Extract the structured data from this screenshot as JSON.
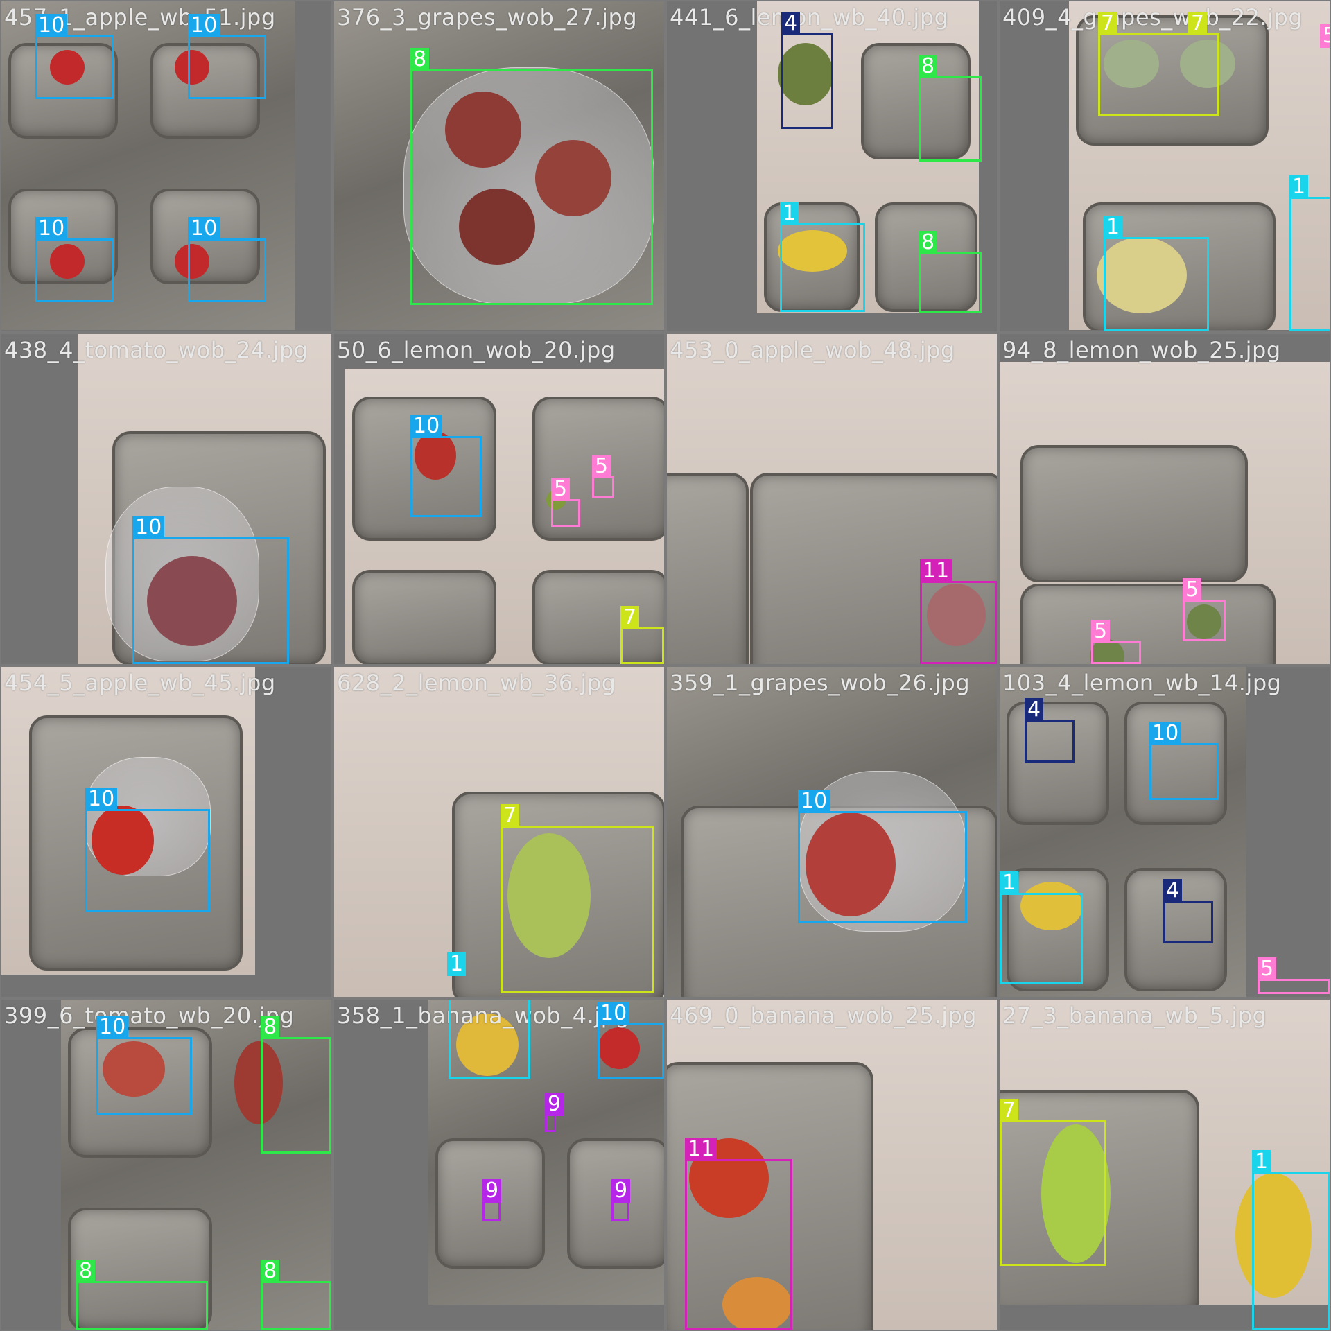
{
  "tiles": [
    {
      "filename": "457_1_apple_wb_51.jpg",
      "labels": [
        "10",
        "10",
        "10",
        "10"
      ]
    },
    {
      "filename": "376_3_grapes_wob_27.jpg",
      "labels": [
        "8"
      ]
    },
    {
      "filename": "441_6_lemon_wb_40.jpg",
      "labels": [
        "4",
        "8",
        "1",
        "8"
      ]
    },
    {
      "filename": "409_4_grapes_wob_22.jpg",
      "labels": [
        "7",
        "7",
        "5",
        "1",
        "1"
      ]
    },
    {
      "filename": "438_4_tomato_wob_24.jpg",
      "labels": [
        "10"
      ]
    },
    {
      "filename": "50_6_lemon_wob_20.jpg",
      "labels": [
        "10",
        "5",
        "5",
        "7"
      ]
    },
    {
      "filename": "453_0_apple_wob_48.jpg",
      "labels": [
        "11"
      ]
    },
    {
      "filename": "94_8_lemon_wob_25.jpg",
      "labels": [
        "5",
        "5"
      ]
    },
    {
      "filename": "454_5_apple_wb_45.jpg",
      "labels": [
        "10"
      ]
    },
    {
      "filename": "628_2_lemon_wb_36.jpg",
      "labels": [
        "7",
        "1"
      ]
    },
    {
      "filename": "359_1_grapes_wob_26.jpg",
      "labels": [
        "10"
      ]
    },
    {
      "filename": "103_4_lemon_wb_14.jpg",
      "labels": [
        "4",
        "10",
        "1",
        "4",
        "5"
      ]
    },
    {
      "filename": "399_6_tomato_wb_20.jpg",
      "labels": [
        "10",
        "8",
        "8",
        "8"
      ]
    },
    {
      "filename": "358_1_banana_wob_4.jpg",
      "labels": [
        "10",
        "9",
        "9",
        "9"
      ]
    },
    {
      "filename": "469_0_banana_wob_25.jpg",
      "labels": [
        "11"
      ]
    },
    {
      "filename": "27_3_banana_wb_5.jpg",
      "labels": [
        "7",
        "1"
      ]
    }
  ],
  "class_colors": {
    "1": "#1ad4ec",
    "4": "#1a2a7a",
    "5": "#ff7bd4",
    "7": "#cde41a",
    "8": "#2ee84a",
    "9": "#b526e8",
    "10": "#18a6ec",
    "11": "#d422b8"
  }
}
